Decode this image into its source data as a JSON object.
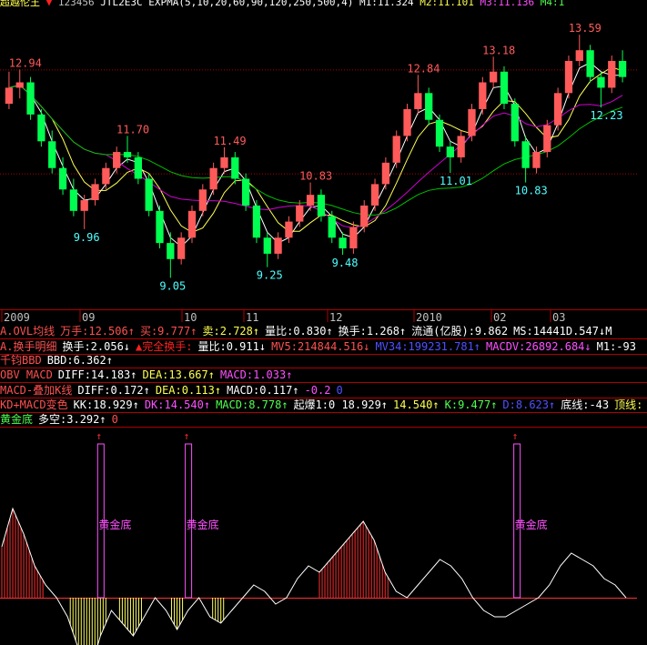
{
  "header": {
    "title": "超越伦王",
    "arrow": "▼",
    "value": "123456",
    "indicator": "JTL2E3C EXPMA(5,10,20,60,90,120,250,500,4)",
    "m1": "M1:11.324",
    "m2": "M2:11.101",
    "m3": "M3:11.136",
    "m4": "M4:1"
  },
  "price_chart": {
    "high_labels": [
      {
        "value": "12.94"
      },
      {
        "value": "11.70"
      },
      {
        "value": "11.49"
      },
      {
        "value": "10.83"
      },
      {
        "value": "12.84"
      },
      {
        "value": "13.18"
      },
      {
        "value": "13.59"
      }
    ],
    "low_labels": [
      {
        "value": "9.96"
      },
      {
        "value": "9.05"
      },
      {
        "value": "9.25"
      },
      {
        "value": "9.48"
      },
      {
        "value": "11.01"
      },
      {
        "value": "10.83"
      },
      {
        "value": "12.23"
      }
    ],
    "candles": [
      [
        12.3,
        12.9,
        12.2,
        12.6
      ],
      [
        12.6,
        12.94,
        12.4,
        12.7
      ],
      [
        12.7,
        12.8,
        12.0,
        12.1
      ],
      [
        12.1,
        12.2,
        11.5,
        11.6
      ],
      [
        11.6,
        11.8,
        11.0,
        11.1
      ],
      [
        11.1,
        11.3,
        10.6,
        10.7
      ],
      [
        10.7,
        10.9,
        10.2,
        10.3
      ],
      [
        10.3,
        10.6,
        9.96,
        10.5
      ],
      [
        10.5,
        10.9,
        10.4,
        10.8
      ],
      [
        10.8,
        11.2,
        10.7,
        11.1
      ],
      [
        11.1,
        11.5,
        11.0,
        11.4
      ],
      [
        11.4,
        11.7,
        11.2,
        11.3
      ],
      [
        11.3,
        11.4,
        10.8,
        10.9
      ],
      [
        10.9,
        11.0,
        10.2,
        10.3
      ],
      [
        10.3,
        10.4,
        9.6,
        9.7
      ],
      [
        9.7,
        9.9,
        9.05,
        9.4
      ],
      [
        9.4,
        9.9,
        9.3,
        9.8
      ],
      [
        9.8,
        10.4,
        9.7,
        10.3
      ],
      [
        10.3,
        10.8,
        10.2,
        10.7
      ],
      [
        10.7,
        11.2,
        10.6,
        11.1
      ],
      [
        11.1,
        11.49,
        11.0,
        11.3
      ],
      [
        11.3,
        11.4,
        10.8,
        10.9
      ],
      [
        10.9,
        11.0,
        10.3,
        10.4
      ],
      [
        10.4,
        10.5,
        9.7,
        9.8
      ],
      [
        9.8,
        9.9,
        9.25,
        9.5
      ],
      [
        9.5,
        9.9,
        9.4,
        9.8
      ],
      [
        9.8,
        10.2,
        9.7,
        10.1
      ],
      [
        10.1,
        10.5,
        10.0,
        10.4
      ],
      [
        10.4,
        10.83,
        10.3,
        10.6
      ],
      [
        10.6,
        10.7,
        10.1,
        10.2
      ],
      [
        10.2,
        10.3,
        9.7,
        9.8
      ],
      [
        9.8,
        9.9,
        9.48,
        9.6
      ],
      [
        9.6,
        10.1,
        9.5,
        10.0
      ],
      [
        10.0,
        10.5,
        9.9,
        10.4
      ],
      [
        10.4,
        10.9,
        10.3,
        10.8
      ],
      [
        10.8,
        11.3,
        10.7,
        11.2
      ],
      [
        11.2,
        11.8,
        11.1,
        11.7
      ],
      [
        11.7,
        12.3,
        11.6,
        12.2
      ],
      [
        12.2,
        12.84,
        12.1,
        12.5
      ],
      [
        12.5,
        12.6,
        11.9,
        12.0
      ],
      [
        12.0,
        12.1,
        11.4,
        11.5
      ],
      [
        11.5,
        11.6,
        11.01,
        11.3
      ],
      [
        11.3,
        11.8,
        11.2,
        11.7
      ],
      [
        11.7,
        12.3,
        11.6,
        12.2
      ],
      [
        12.2,
        12.8,
        12.1,
        12.7
      ],
      [
        12.7,
        13.18,
        12.6,
        12.9
      ],
      [
        12.9,
        13.0,
        12.2,
        12.3
      ],
      [
        12.3,
        12.4,
        11.5,
        11.6
      ],
      [
        11.6,
        11.7,
        10.83,
        11.1
      ],
      [
        11.1,
        11.5,
        11.0,
        11.4
      ],
      [
        11.4,
        12.0,
        11.3,
        11.9
      ],
      [
        11.9,
        12.6,
        11.8,
        12.5
      ],
      [
        12.5,
        13.2,
        12.4,
        13.1
      ],
      [
        13.1,
        13.59,
        13.0,
        13.3
      ],
      [
        13.3,
        13.4,
        12.7,
        12.8
      ],
      [
        12.8,
        12.9,
        12.23,
        12.6
      ],
      [
        12.6,
        13.2,
        12.5,
        13.1
      ],
      [
        13.1,
        13.3,
        12.7,
        12.8
      ]
    ]
  },
  "x_axis": {
    "labels": [
      "2009",
      "09",
      "10",
      "11",
      "12",
      "2010",
      "02",
      "03"
    ]
  },
  "info_rows": [
    {
      "name": "row-ovl",
      "parts": [
        {
          "t": "A.OVL均线",
          "c": "#ff5050"
        },
        {
          "t": "万手:12.506↑",
          "c": "#ff5050"
        },
        {
          "t": "买:9.777↑",
          "c": "#ff5050"
        },
        {
          "t": "卖:2.728↑",
          "c": "#ffff50"
        },
        {
          "t": "量比:0.830↑",
          "c": "#ffffff"
        },
        {
          "t": "换手:1.268↑",
          "c": "#ffffff"
        },
        {
          "t": "流通(亿股):9.862",
          "c": "#ffffff"
        },
        {
          "t": "MS:14441D.547↓M",
          "c": "#ffffff"
        }
      ]
    },
    {
      "name": "row-turnover",
      "parts": [
        {
          "t": "A.换手明细",
          "c": "#ff5050"
        },
        {
          "t": "换手:2.056↓",
          "c": "#ffffff"
        },
        {
          "t": "▲完全换手:",
          "c": "#ff2020"
        },
        {
          "t": "量比:0.911↓",
          "c": "#ffffff"
        },
        {
          "t": "MV5:214844.516↓",
          "c": "#ff5050"
        },
        {
          "t": "MV34:199231.781↑",
          "c": "#5050ff"
        },
        {
          "t": "MACDV:26892.684↓",
          "c": "#ff50ff"
        },
        {
          "t": "M1:-93",
          "c": "#ffffff"
        }
      ]
    },
    {
      "name": "row-bbd",
      "parts": [
        {
          "t": "千钧BBD",
          "c": "#ff5050"
        },
        {
          "t": "BBD:6.362↑",
          "c": "#ffffff"
        }
      ]
    },
    {
      "name": "row-obv",
      "parts": [
        {
          "t": "OBV MACD",
          "c": "#ff5050"
        },
        {
          "t": "DIFF:14.183↑",
          "c": "#ffffff"
        },
        {
          "t": "DEA:13.667↑",
          "c": "#ffff50"
        },
        {
          "t": "MACD:1.033↑",
          "c": "#ff50ff"
        }
      ]
    },
    {
      "name": "row-macd-k",
      "parts": [
        {
          "t": "MACD-叠加K线",
          "c": "#ff5050"
        },
        {
          "t": "DIFF:0.172↑",
          "c": "#ffffff"
        },
        {
          "t": "DEA:0.113↑",
          "c": "#ffff50"
        },
        {
          "t": "MACD:0.117↑",
          "c": "#ffffff"
        },
        {
          "t": "-0.2",
          "c": "#ff50ff"
        },
        {
          "t": "0",
          "c": "#5050ff"
        }
      ]
    },
    {
      "name": "row-kd",
      "parts": [
        {
          "t": "KD+MACD变色",
          "c": "#ff5050"
        },
        {
          "t": "KK:18.929↑",
          "c": "#ffffff"
        },
        {
          "t": "DK:14.540↑",
          "c": "#ff50ff"
        },
        {
          "t": "MACD:8.778↑",
          "c": "#50ff50"
        },
        {
          "t": "起爆1:0 18.929↑",
          "c": "#ffffff"
        },
        {
          "t": "14.540↑",
          "c": "#ffff50"
        },
        {
          "t": "K:9.477↑",
          "c": "#50ff50"
        },
        {
          "t": "D:8.623↑",
          "c": "#5050ff"
        },
        {
          "t": "底线:-43",
          "c": "#ffffff"
        },
        {
          "t": "顶线:",
          "c": "#ffff50"
        }
      ]
    },
    {
      "name": "row-golden",
      "parts": [
        {
          "t": "黄金底",
          "c": "#50ff50"
        },
        {
          "t": "多空:3.292↑",
          "c": "#ffffff"
        },
        {
          "t": "0",
          "c": "#ff5050"
        }
      ]
    }
  ],
  "golden_bottom": {
    "signal_label": "黄金底",
    "signal_positions": [
      9,
      17,
      47
    ],
    "curve": [
      8,
      14,
      10,
      5,
      2,
      0,
      -3,
      -8,
      -12,
      -6,
      -2,
      -4,
      -6,
      -3,
      0,
      -2,
      -5,
      -2,
      0,
      -3,
      -4,
      -2,
      0,
      2,
      1,
      -1,
      0,
      3,
      5,
      4,
      6,
      8,
      10,
      12,
      9,
      4,
      1,
      0,
      2,
      4,
      6,
      5,
      3,
      0,
      -2,
      -3,
      -3,
      -2,
      -1,
      0,
      2,
      5,
      7,
      6,
      5,
      3,
      2,
      0
    ]
  },
  "colors": {
    "up": "#ff5a5a",
    "down": "#00ff50",
    "ma_white": "#ffffff",
    "ma_yellow": "#ffff50",
    "ma_magenta": "#d000d0",
    "ma_green": "#00c000",
    "high_label": "#ff5a5a",
    "low_label": "#50ffff",
    "grid": "#b00000",
    "signal": "#ff50ff"
  }
}
